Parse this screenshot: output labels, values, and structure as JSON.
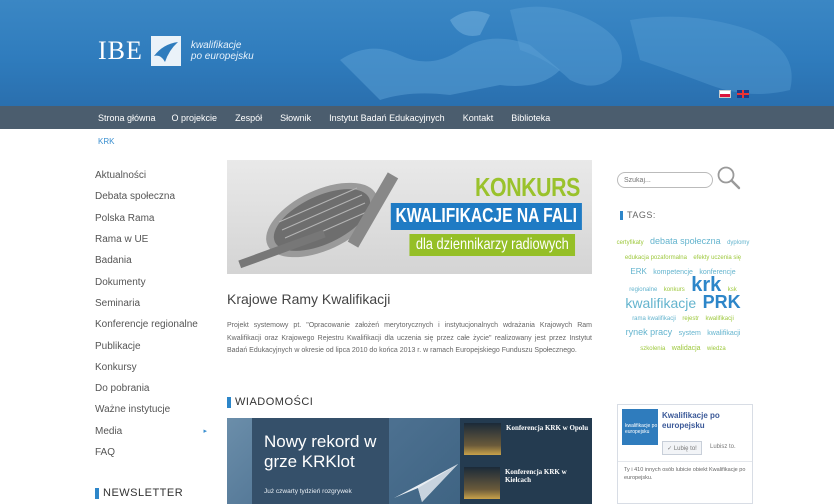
{
  "header": {
    "logo_text": "IBE",
    "logo_subtitle_line1": "kwalifikacje",
    "logo_subtitle_line2": "po europejsku"
  },
  "nav": {
    "items": [
      "Strona główna",
      "O projekcie",
      "Zespół",
      "Słownik",
      "Instytut Badań Edukacyjnych",
      "Kontakt",
      "Biblioteka"
    ]
  },
  "breadcrumb": "KRK",
  "leftnav": {
    "items": [
      "Aktualności",
      "Debata społeczna",
      "Polska Rama",
      "Rama w UE",
      "Badania",
      "Dokumenty",
      "Seminaria",
      "Konferencje regionalne",
      "Publikacje",
      "Konkursy",
      "Do pobrania",
      "Ważne instytucje",
      "Media",
      "FAQ"
    ],
    "media_arrow": "▸",
    "newsletter_heading": "NEWSLETTER"
  },
  "banner": {
    "konkurs": "KONKURS",
    "kwalifikacje": "KWALIFIKACJE NA FALI",
    "dla": "dla dziennikarzy radiowych"
  },
  "main": {
    "title": "Krajowe Ramy Kwalifikacji",
    "text": "Projekt systemowy pt. \"Opracowanie założeń merytorycznych i instytucjonalnych wdrażania Krajowych Ram Kwalifikacji oraz Krajowego Rejestru Kwalifikacji dla uczenia się przez całe życie\" realizowany jest przez Instytut Badań Edukacyjnych w okresie od lipca 2010 do końca 2013 r. w ramach Europejskiego Funduszu Społecznego.",
    "news_heading": "WIADOMOŚCI"
  },
  "news": {
    "feature_title": "Nowy rekord w grze KRKlot",
    "feature_sub": "Już czwarty tydzień rozgrywek",
    "side": [
      {
        "title": "Konferencja KRK w Opolu"
      },
      {
        "title": "Konferencja KRK w Kielcach"
      }
    ]
  },
  "right": {
    "search_placeholder": "Szukaj...",
    "tags_heading": "TAGS:",
    "tags": [
      {
        "text": "certyfikaty",
        "size": "t6",
        "green": true
      },
      {
        "text": "debata społeczna",
        "size": "t9"
      },
      {
        "text": "dyplomy",
        "size": "t6"
      },
      {
        "text": "edukacja pozaformalna",
        "size": "t6",
        "green": true
      },
      {
        "text": "efekty uczenia się",
        "size": "t6",
        "green": true
      },
      {
        "text": "ERK",
        "size": "t8"
      },
      {
        "text": "kompetencje",
        "size": "t7"
      },
      {
        "text": "konferencje",
        "size": "t7"
      },
      {
        "text": "regionalne",
        "size": "t6"
      },
      {
        "text": "konkurs",
        "size": "t6",
        "green": true
      },
      {
        "text": "krk",
        "size": "t20"
      },
      {
        "text": "ksk",
        "size": "t6",
        "green": true
      },
      {
        "text": "kwalifikacje",
        "size": "t14"
      },
      {
        "text": "PRK",
        "size": "t18"
      },
      {
        "text": "rama kwalifikacji",
        "size": "t6"
      },
      {
        "text": "rejestr",
        "size": "t6",
        "green": true
      },
      {
        "text": "kwalifikacji",
        "size": "t6",
        "green": true
      },
      {
        "text": "rynek pracy",
        "size": "t9"
      },
      {
        "text": "system",
        "size": "t7"
      },
      {
        "text": "kwalifikacji",
        "size": "t7"
      },
      {
        "text": "szkolenia",
        "size": "t6",
        "green": true
      },
      {
        "text": "walidacja",
        "size": "t7",
        "green": true
      },
      {
        "text": "wiedza",
        "size": "t6",
        "green": true
      }
    ],
    "fb": {
      "pic_text": "kwalifikacje po europejsku",
      "name": "Kwalifikacje po europejsku",
      "like": "✓ Lubię to!",
      "count": "Lubisz to.",
      "text": "Ty i 410 innych osób lubicie obiekt Kwalifikacje po europejsku."
    }
  }
}
